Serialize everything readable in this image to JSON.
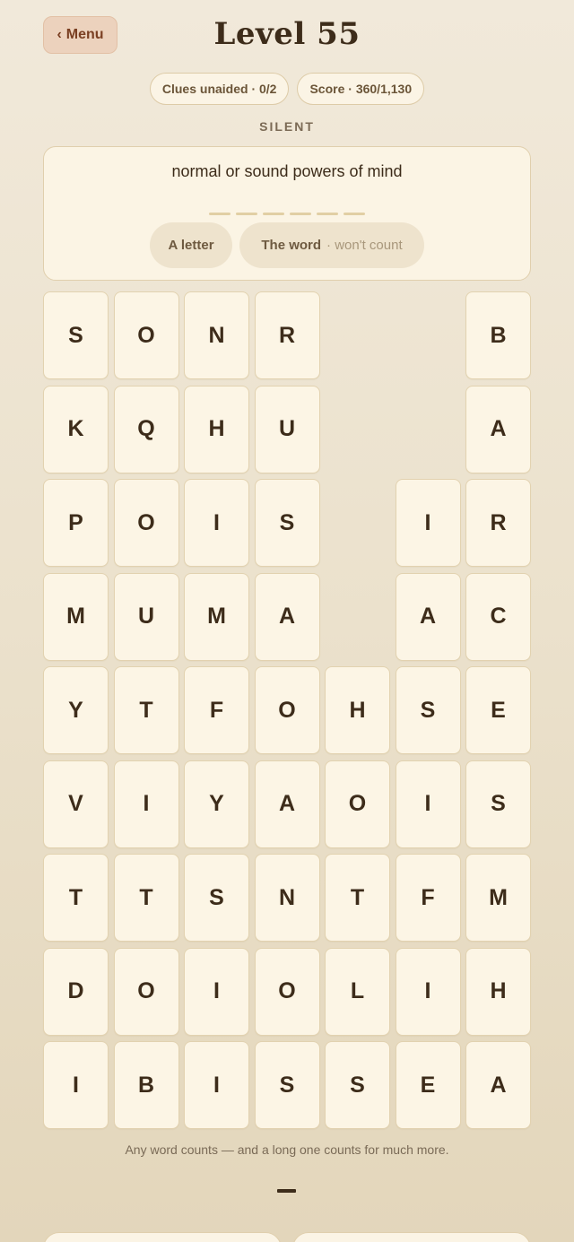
{
  "header": {
    "menu_label": "Menu",
    "menu_icon": "chevron-left-icon",
    "title": "Level 55"
  },
  "stats": {
    "clues": "Clues unaided · 0/2",
    "score": "Score · 360/1,130"
  },
  "category": "SILENT",
  "clue": {
    "text": "normal or sound powers of mind",
    "blank_count": 6,
    "hint_letter": "A letter",
    "hint_word": "The word",
    "hint_word_note": "· won't count"
  },
  "grid": {
    "columns": [
      [
        "S",
        "K",
        "P",
        "M",
        "Y",
        "V",
        "T",
        "D",
        "I"
      ],
      [
        "O",
        "Q",
        "O",
        "U",
        "T",
        "I",
        "T",
        "O",
        "B"
      ],
      [
        "N",
        "H",
        "I",
        "M",
        "F",
        "Y",
        "S",
        "I",
        "I"
      ],
      [
        "R",
        "U",
        "S",
        "A",
        "O",
        "A",
        "N",
        "O",
        "S"
      ],
      [
        "H",
        "O",
        "T",
        "L",
        "S"
      ],
      [
        "I",
        "A",
        "S",
        "I",
        "F",
        "I",
        "E"
      ],
      [
        "B",
        "A",
        "R",
        "C",
        "E",
        "S",
        "M",
        "H",
        "A"
      ]
    ]
  },
  "footer_note": "Any word counts — and a long one counts for much more."
}
